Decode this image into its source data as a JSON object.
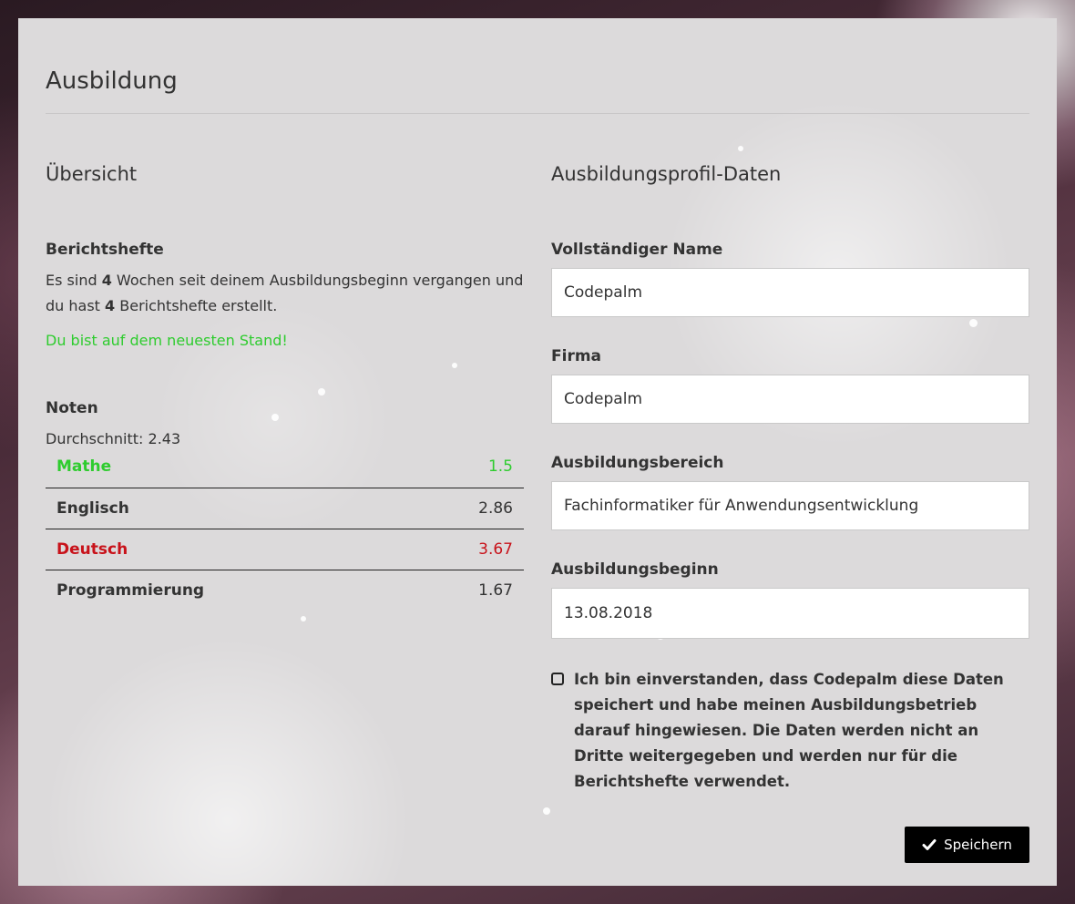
{
  "page": {
    "title": "Ausbildung"
  },
  "overview": {
    "title": "Übersicht",
    "reports": {
      "title": "Berichtshefte",
      "text_1": "Es sind ",
      "weeks": "4",
      "text_2": " Wochen seit deinem Ausbildungsbeginn vergangen und du hast ",
      "count": "4",
      "text_3": " Berichtshefte erstellt.",
      "status": "Du bist auf dem neuesten Stand!"
    },
    "grades": {
      "title": "Noten",
      "average_label": "Durchschnitt: ",
      "average_value": "2.43",
      "items": [
        {
          "subject": "Mathe",
          "grade": "1.5",
          "status_color": "#2ecc2e"
        },
        {
          "subject": "Englisch",
          "grade": "2.86",
          "status_color": "#333333"
        },
        {
          "subject": "Deutsch",
          "grade": "3.67",
          "status_color": "#c8121a"
        },
        {
          "subject": "Programmierung",
          "grade": "1.67",
          "status_color": "#333333"
        }
      ]
    }
  },
  "profile": {
    "title": "Ausbildungsprofil-Daten",
    "fields": {
      "name": {
        "label": "Vollständiger Name",
        "value": "Codepalm"
      },
      "company": {
        "label": "Firma",
        "value": "Codepalm"
      },
      "area": {
        "label": "Ausbildungsbereich",
        "value": "Fachinformatiker für Anwendungsentwicklung"
      },
      "start": {
        "label": "Ausbildungsbeginn",
        "value": "13.08.2018"
      }
    },
    "consent": {
      "checked": false,
      "text": "Ich bin einverstanden, dass Codepalm diese Daten speichert und habe meinen Ausbildungsbetrieb darauf hingewiesen. Die Daten werden nicht an Dritte weitergegeben und werden nur für die Berichtshefte verwendet."
    },
    "save_label": "Speichern",
    "save_icon": "check-icon"
  }
}
